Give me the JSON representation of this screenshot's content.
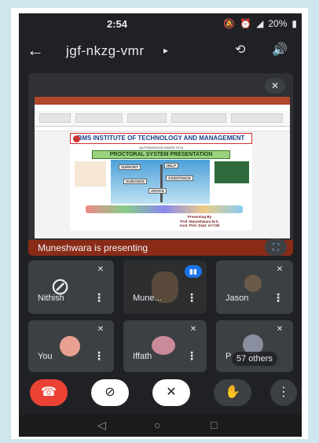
{
  "status_bar": {
    "time": "2:54",
    "status_icons": [
      "chat-bubble-icon",
      "dot-icon",
      "mute-icon",
      "alarm-icon",
      "volte-icon",
      "4g-signal-icon"
    ],
    "battery": "20%"
  },
  "top_bar": {
    "meeting_code": "jgf-nkzg-vmr",
    "icons": [
      "back-arrow-icon",
      "caret-right-icon",
      "switch-camera-icon",
      "speaker-icon"
    ]
  },
  "presentation": {
    "presenter_text": "Muneshwara is presenting",
    "slide": {
      "institute": "BMS INSTITUTE OF TECHNOLOGY AND MANAGEMENT",
      "subtitle": "(AUTONOMOUS UNDER VTU)",
      "title": "PROCTORAL SYSTEM PRESENTATION",
      "signs": [
        "SUPPORT",
        "HELP",
        "GUIDANCE",
        "ASSISTANCE",
        "ADVICE"
      ],
      "presented_by": [
        "Presenting By",
        "Prof. Muneshwara M.S,",
        "Asst. Prof. Dept. of CSE"
      ]
    }
  },
  "participants": [
    {
      "name": "Nithish",
      "mic_muted": true,
      "camera": "off"
    },
    {
      "name": "Mune...",
      "mic_muted": false,
      "speaking": true
    },
    {
      "name": "Jason",
      "mic_muted": true
    },
    {
      "name": "You",
      "mic_muted": true
    },
    {
      "name": "Iffath",
      "mic_muted": true
    },
    {
      "name": "P",
      "mic_muted": true,
      "others_label": "57 others"
    }
  ],
  "colors": {
    "background": "#202124",
    "tile": "#3c4043",
    "end_call": "#ea4335",
    "speaking": "#1a73e8",
    "presenting_bar": "#8a2b18"
  }
}
